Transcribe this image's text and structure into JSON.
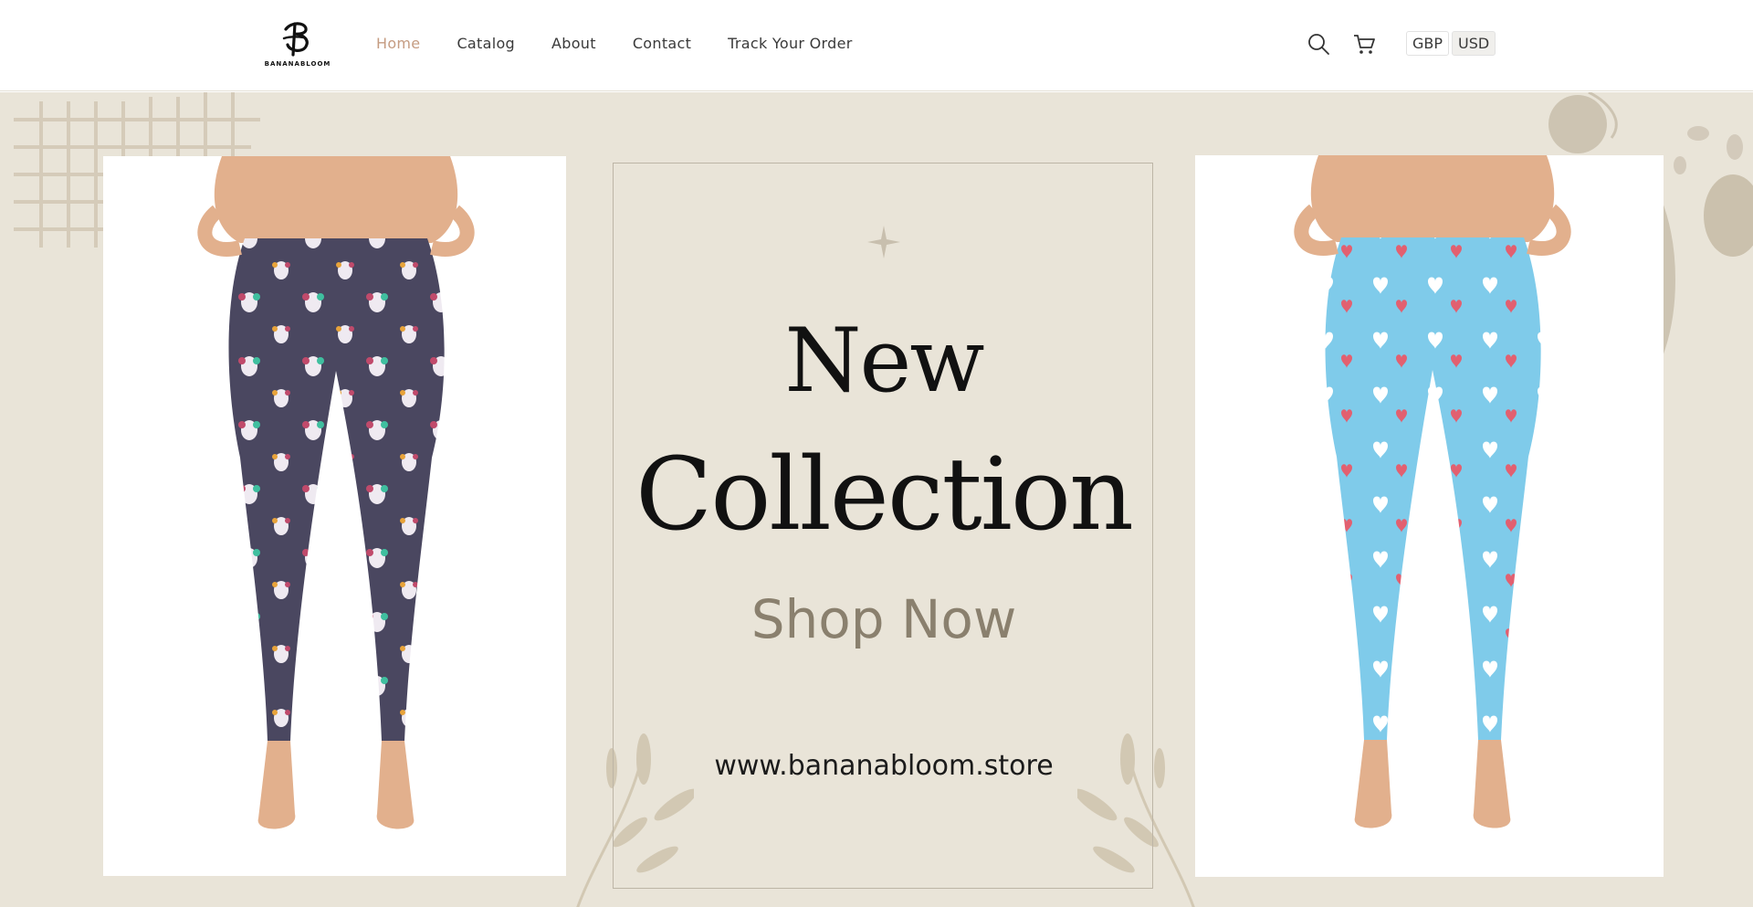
{
  "brand": {
    "logo_text": "BANANABLOOM"
  },
  "nav": {
    "items": [
      {
        "label": "Home",
        "active": true
      },
      {
        "label": "Catalog"
      },
      {
        "label": "About"
      },
      {
        "label": "Contact"
      },
      {
        "label": "Track Your Order"
      }
    ]
  },
  "header_icons": [
    "search-icon",
    "cart-icon"
  ],
  "currency": {
    "options": [
      "GBP",
      "USD"
    ],
    "selected": "USD"
  },
  "hero": {
    "title_line1": "New",
    "title_line2": "Collection",
    "cta": "Shop Now",
    "url": "www.bananabloom.store"
  },
  "products": [
    {
      "name": "dog-print-leggings",
      "color": "#4a4760"
    },
    {
      "name": "heart-print-leggings",
      "color": "#7fcbea"
    }
  ],
  "colors": {
    "accent": "#c59c82",
    "banner_bg": "#e9e4d8",
    "cta_text": "#8a806e"
  }
}
